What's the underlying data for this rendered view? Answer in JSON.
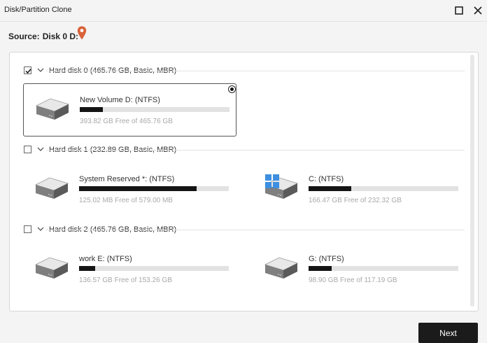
{
  "window": {
    "title": "Disk/Partition Clone"
  },
  "source": {
    "label": "Source:",
    "value": "Disk 0 D:"
  },
  "disks": [
    {
      "header": "Hard disk 0 (465.76 GB, Basic, MBR)",
      "checked": true,
      "partitions": [
        {
          "name": "New Volume D: (NTFS)",
          "free_text": "393.82 GB Free of 465.76 GB",
          "used_fraction": 0.154,
          "selected": true,
          "windows_logo": false
        }
      ]
    },
    {
      "header": "Hard disk 1 (232.89 GB, Basic, MBR)",
      "checked": false,
      "partitions": [
        {
          "name": "System Reserved *: (NTFS)",
          "free_text": "125.02 MB Free of 579.00 MB",
          "used_fraction": 0.784,
          "selected": false,
          "windows_logo": false
        },
        {
          "name": "C: (NTFS)",
          "free_text": "166.47 GB Free of 232.32 GB",
          "used_fraction": 0.283,
          "selected": false,
          "windows_logo": true
        }
      ]
    },
    {
      "header": "Hard disk 2 (465.76 GB, Basic, MBR)",
      "checked": false,
      "partitions": [
        {
          "name": "work E: (NTFS)",
          "free_text": "136.57 GB Free of 153.26 GB",
          "used_fraction": 0.109,
          "selected": false,
          "windows_logo": false
        },
        {
          "name": "G: (NTFS)",
          "free_text": "98.90 GB Free of 117.19 GB",
          "used_fraction": 0.156,
          "selected": false,
          "windows_logo": false
        }
      ]
    }
  ],
  "footer": {
    "next_label": "Next"
  },
  "colors": {
    "bar_fill": "#141414",
    "bar_track": "#e2e2e2",
    "pin": "#d9633a",
    "windows_logo": "#3d8fe0"
  }
}
